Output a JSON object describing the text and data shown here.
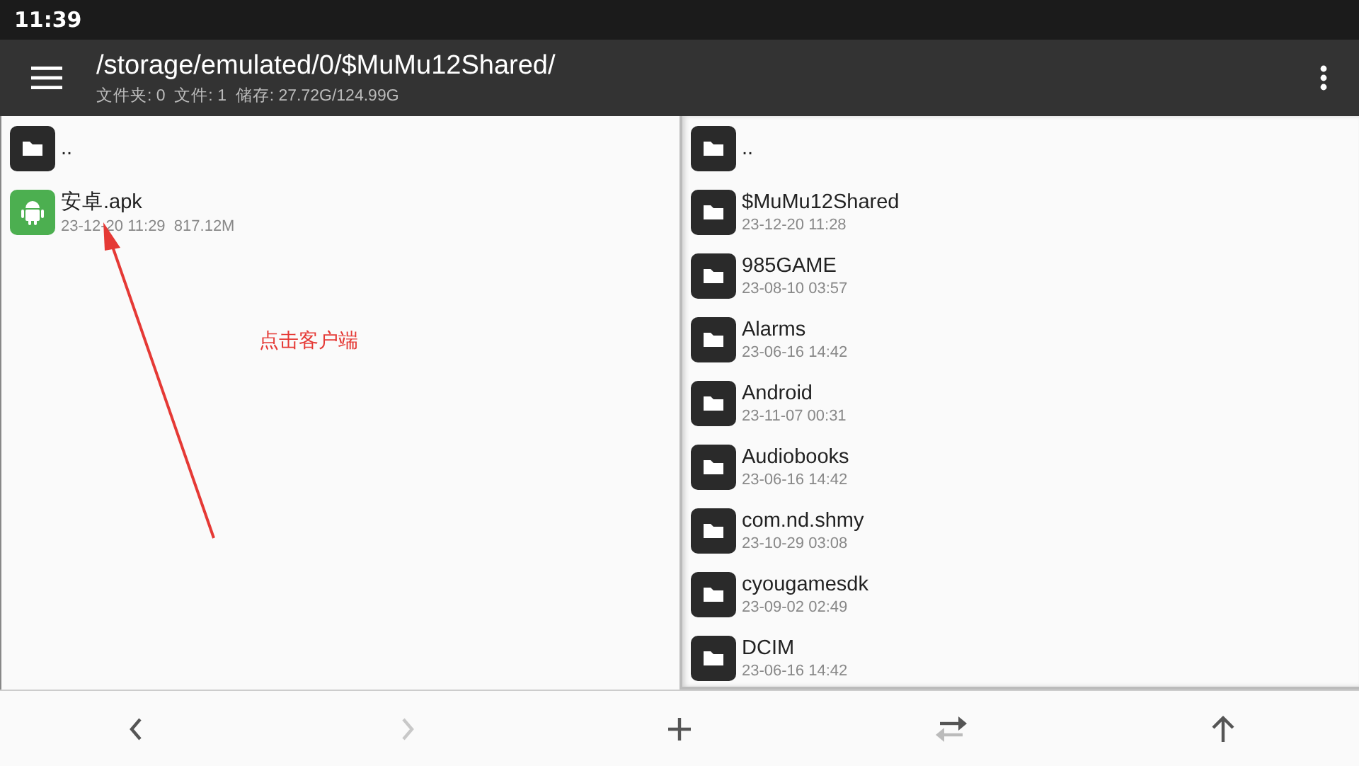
{
  "status_bar": {
    "time": "11:39"
  },
  "toolbar": {
    "path": "/storage/emulated/0/$MuMu12Shared/",
    "info": "文件夹: 0  文件: 1  储存: 27.72G/124.99G"
  },
  "left_panel": {
    "items": [
      {
        "kind": "parent",
        "name": ".."
      },
      {
        "kind": "apk",
        "name": "安卓.apk",
        "meta": "23-12-20 11:29  817.12M"
      }
    ],
    "annotation": {
      "text": "点击客户端"
    }
  },
  "right_panel": {
    "items": [
      {
        "name": ".."
      },
      {
        "name": "$MuMu12Shared",
        "meta": "23-12-20 11:28"
      },
      {
        "name": "985GAME",
        "meta": "23-08-10 03:57"
      },
      {
        "name": "Alarms",
        "meta": "23-06-16 14:42"
      },
      {
        "name": "Android",
        "meta": "23-11-07 00:31"
      },
      {
        "name": "Audiobooks",
        "meta": "23-06-16 14:42"
      },
      {
        "name": "com.nd.shmy",
        "meta": "23-10-29 03:08"
      },
      {
        "name": "cyougamesdk",
        "meta": "23-09-02 02:49"
      },
      {
        "name": "DCIM",
        "meta": "23-06-16 14:42"
      }
    ]
  },
  "bottom_bar": [
    {
      "kind": "back",
      "disabled": false
    },
    {
      "kind": "forward",
      "disabled": true
    },
    {
      "kind": "add",
      "disabled": false
    },
    {
      "kind": "swap",
      "disabled": false
    },
    {
      "kind": "up",
      "disabled": false
    }
  ]
}
